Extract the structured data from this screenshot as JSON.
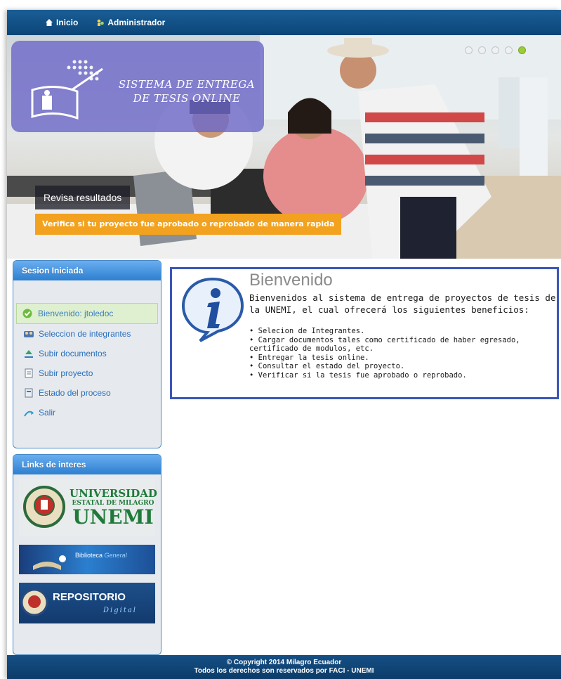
{
  "nav": {
    "items": [
      {
        "label": "Inicio",
        "icon": "home-icon"
      },
      {
        "label": "Administrador",
        "icon": "admin-icon"
      }
    ]
  },
  "banner": {
    "logo_line1": "SISTEMA DE ENTREGA",
    "logo_line2": "DE TESIS ONLINE",
    "slide_count": 5,
    "active_slide": 5,
    "caption_title": "Revisa resultados",
    "caption_subtitle": "Verifica si tu proyecto fue aprobado o reprobado de manera rapida",
    "caption_accent": "#f2a21e"
  },
  "session_panel": {
    "title": "Sesion Iniciada",
    "welcome": "Bienvenido: jtoledoc",
    "items": [
      {
        "label": "Seleccion de integrantes",
        "icon": "group-icon"
      },
      {
        "label": "Subir documentos",
        "icon": "upload-icon"
      },
      {
        "label": "Subir proyecto",
        "icon": "document-icon"
      },
      {
        "label": "Estado del proceso",
        "icon": "status-icon"
      },
      {
        "label": "Salir",
        "icon": "exit-icon"
      }
    ]
  },
  "links_panel": {
    "title": "Links de interes",
    "links": [
      {
        "line1": "UNIVERSIDAD",
        "line2": "ESTATAL DE MILAGRO",
        "line3": "UNEMI"
      },
      {
        "line1": "Biblioteca",
        "line2": "General"
      },
      {
        "line1": "REPOSITORIO",
        "line2": "Digital"
      }
    ]
  },
  "welcome": {
    "title": "Bienvenido",
    "intro": "Bienvenidos al sistema de entrega de proyectos de tesis de la UNEMI, el cual ofrecerá los siguientes beneficios:",
    "benefits": [
      "• Selecion de Integrantes.",
      "• Cargar documentos tales como certificado de haber egresado, certificado de modulos, etc.",
      "• Entregar la tesis online.",
      "• Consultar el estado del proyecto.",
      "• Verificar si la tesis fue aprobado o reprobado."
    ]
  },
  "footer": {
    "line1": "© Copyright 2014 Milagro Ecuador",
    "line2": "Todos los derechos son reservados por FACI - UNEMI"
  },
  "colors": {
    "nav_bg": "#0b4578",
    "panel_head": "#2c7fd0",
    "link_text": "#2a6fbd",
    "welcome_border": "#3b56b8"
  }
}
